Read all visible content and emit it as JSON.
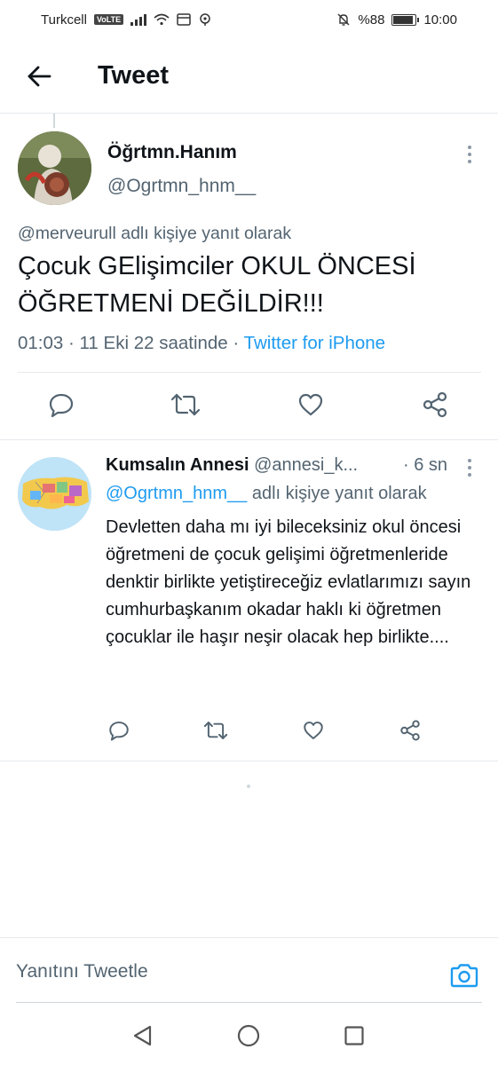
{
  "status_bar": {
    "carrier": "Turkcell",
    "volte": "VoLTE",
    "battery": "%88",
    "battery_level": 0.88,
    "time": "10:00"
  },
  "header": {
    "title": "Tweet"
  },
  "main_tweet": {
    "name": "Öğrtmn.Hanım",
    "handle": "@Ogrtmn_hnm__",
    "reply_context": "@merveurull adlı kişiye yanıt olarak",
    "text": "Çocuk GElişimciler OKUL ÖNCESİ ÖĞRETMENİ DEĞİLDİR!!!",
    "time": "01:03",
    "date": "11 Eki 22 saatinde",
    "source": "Twitter for iPhone"
  },
  "reply_tweet": {
    "name": "Kumsalın Annesi",
    "handle": "@annesi_k...",
    "time": "· 6 sn",
    "mention": "@Ogrtmn_hnm__",
    "reply_suffix": " adlı kişiye yanıt olarak",
    "text": "Devletten daha mı iyi bileceksiniz okul öncesi öğretmeni de çocuk gelişimi öğretmenleride denktir birlikte yetiştireceğiz evlatlarımızı sayın cumhurbaşkanım okadar haklı ki öğretmen çocuklar ile haşır neşir olacak hep birlikte...."
  },
  "compose": {
    "placeholder": "Yanıtını Tweetle"
  },
  "icons": {
    "reply": "reply-icon",
    "retweet": "retweet-icon",
    "like": "heart-icon",
    "share": "share-icon",
    "camera": "camera-icon",
    "back": "arrow-left-icon"
  },
  "colors": {
    "accent": "#1d9bf0",
    "text": "#0f1419",
    "secondary": "#536471"
  }
}
